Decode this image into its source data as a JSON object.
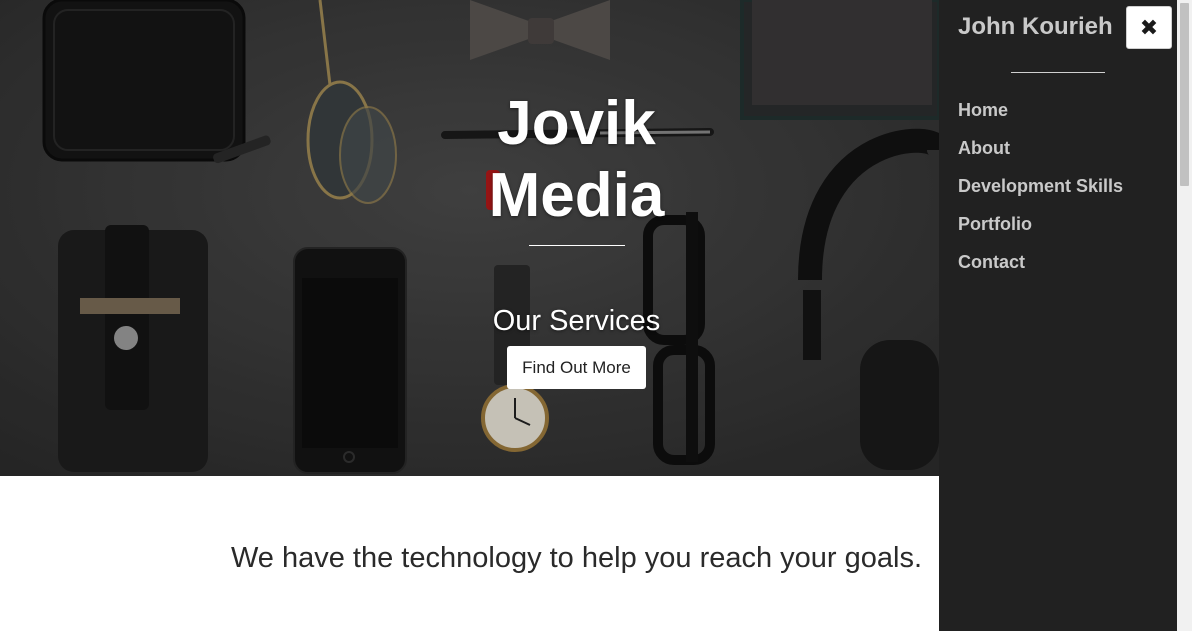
{
  "hero": {
    "title_line1": "Jovik",
    "title_line2": "Media",
    "subtitle": "Our Services",
    "cta_label": "Find Out More"
  },
  "content": {
    "tagline": "We have the technology to help you reach your goals."
  },
  "sidebar": {
    "brand": "John Kourieh",
    "close_icon": "close-icon",
    "items": [
      {
        "label": "Home"
      },
      {
        "label": "About"
      },
      {
        "label": "Development Skills"
      },
      {
        "label": "Portfolio"
      },
      {
        "label": "Contact"
      }
    ]
  },
  "colors": {
    "sidebar_bg": "#212121",
    "sidebar_text": "#c9c9c9",
    "hero_text": "#ffffff",
    "button_bg": "#ffffff"
  }
}
